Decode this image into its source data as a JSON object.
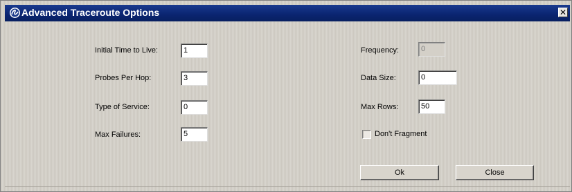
{
  "window": {
    "title": "Advanced Traceroute Options",
    "close_glyph": "✕",
    "titlebar_color": "#0a2470"
  },
  "left_fields": [
    {
      "label": "Initial Time to Live:",
      "value": "1"
    },
    {
      "label": "Probes Per Hop:",
      "value": "3"
    },
    {
      "label": "Type of Service:",
      "value": "0"
    },
    {
      "label": "Max Failures:",
      "value": "5"
    }
  ],
  "right_fields": [
    {
      "label": "Frequency:",
      "value": "0",
      "disabled": true
    },
    {
      "label": "Data Size:",
      "value": "0",
      "disabled": false
    },
    {
      "label": "Max Rows:",
      "value": "50",
      "disabled": false
    }
  ],
  "dont_fragment": {
    "label": "Don't Fragment",
    "checked": false
  },
  "buttons": {
    "ok": "Ok",
    "close": "Close"
  }
}
